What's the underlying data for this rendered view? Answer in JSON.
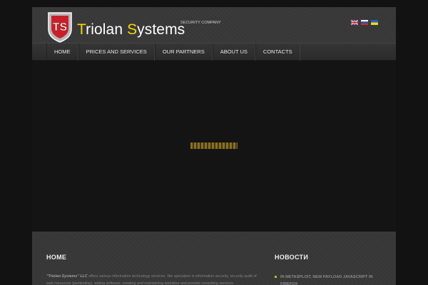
{
  "header": {
    "logo_initials": "TS",
    "logo_first": "riolan",
    "logo_first_initial": "T",
    "logo_second_initial": "S",
    "logo_second": "ystems",
    "tagline": "SECURITY COMPANY",
    "flags": [
      {
        "name": "english-flag-icon"
      },
      {
        "name": "russian-flag-icon"
      },
      {
        "name": "ukrainian-flag-icon"
      }
    ]
  },
  "nav": {
    "items": [
      {
        "label": "HOME"
      },
      {
        "label": "PRICES AND SERVICES"
      },
      {
        "label": "OUR PARTNERS"
      },
      {
        "label": "ABOUT US"
      },
      {
        "label": "CONTACTS"
      }
    ]
  },
  "footer": {
    "home_heading": "HOME",
    "home_company": "\"Triolan Systems\" LLC",
    "home_text": " offers various information technology services. We specialize in information security, security audit of web resources (pentesting), writing software, creating and maintaining websites and provide consulting services.",
    "news_heading": "НОВОСТИ",
    "news_items": [
      {
        "title": "IN METASPLOIT, NEW PAYLOAD JAVASCRIPT IN FIREFOX"
      }
    ]
  },
  "colors": {
    "accent_yellow": "#f4d60a",
    "logo_red": "#c8202a",
    "news_bullet": "#d6b12a"
  }
}
